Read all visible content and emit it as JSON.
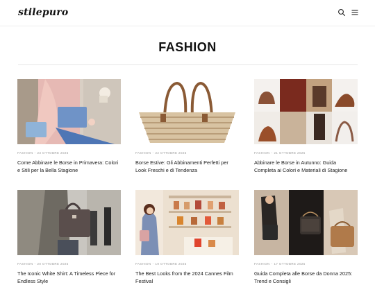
{
  "header": {
    "logo": "stilepuro"
  },
  "section": {
    "title": "FASHION"
  },
  "articles": [
    {
      "category": "FASHION",
      "date": "23 OTTOBRE 2025",
      "title": "Come Abbinare le Borse in Primavera: Colori e Stili per la Bella Stagione"
    },
    {
      "category": "FASHION",
      "date": "22 OTTOBRE 2025",
      "title": "Borse Estive: Gli Abbinamenti Perfetti per Look Freschi e di Tendenza"
    },
    {
      "category": "FASHION",
      "date": "21 OTTOBRE 2025",
      "title": "Abbinare le Borse in Autunno: Guida Completa ai Colori e Materiali di Stagione"
    },
    {
      "category": "FASHION",
      "date": "20 OTTOBRE 2025",
      "title": "The Iconic White Shirt: A Timeless Piece for Endless Style"
    },
    {
      "category": "FASHION",
      "date": "19 OTTOBRE 2025",
      "title": "The Best Looks from the 2024 Cannes Film Festival"
    },
    {
      "category": "FASHION",
      "date": "17 OTTOBRE 2025",
      "title": "Guida Completa alle Borse da Donna 2025: Trend e Consigli"
    }
  ]
}
